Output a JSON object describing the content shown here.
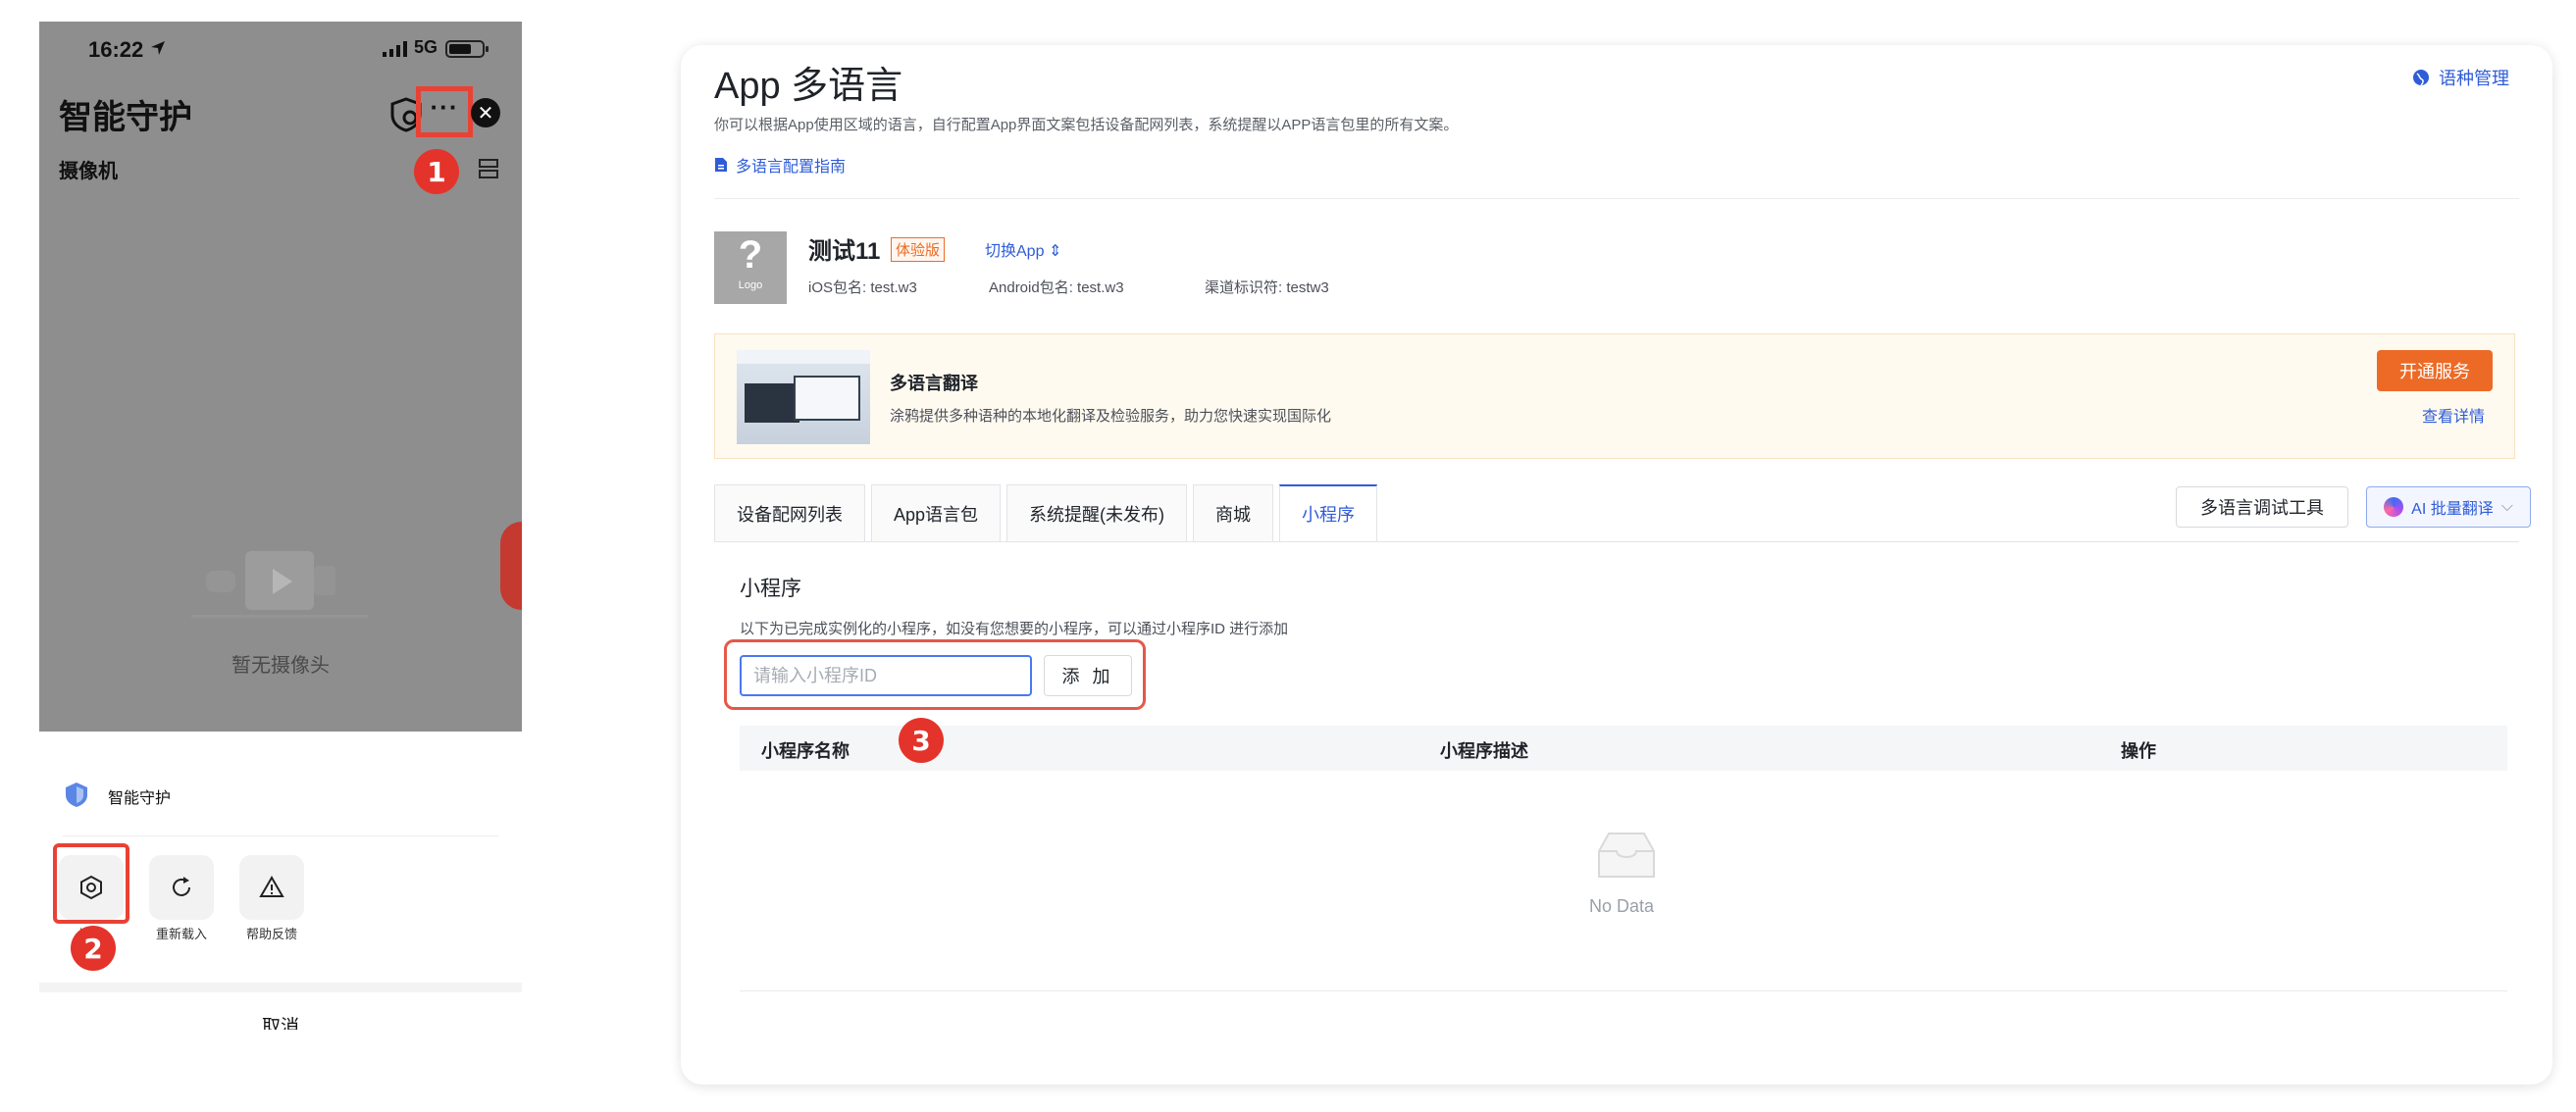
{
  "phone": {
    "status": {
      "time": "16:22",
      "network": "5G"
    },
    "title": "智能守护",
    "subtitle": "摄像机",
    "more_label": "···",
    "empty_text": "暂无摄像头",
    "sheet": {
      "title": "智能守护",
      "actions": [
        {
          "label": "设置",
          "icon": "settings-icon"
        },
        {
          "label": "重新载入",
          "icon": "reload-icon"
        },
        {
          "label": "帮助反馈",
          "icon": "warning-icon"
        }
      ],
      "cancel": "取消"
    }
  },
  "badges": [
    "1",
    "2",
    "3"
  ],
  "console": {
    "title": "App 多语言",
    "description": "你可以根据App使用区域的语言，自行配置App界面文案包括设备配网列表，系统提醒以APP语言包里的所有文案。",
    "guide_link": "多语言配置指南",
    "lang_mgmt": "语种管理",
    "app": {
      "logo_mark": "?",
      "logo_text": "Logo",
      "name": "测试11",
      "tag": "体验版",
      "switch": "切换App",
      "ios": "iOS包名: test.w3",
      "android": "Android包名: test.w3",
      "channel": "渠道标识符: testw3"
    },
    "promo": {
      "title": "多语言翻译",
      "desc": "涂鸦提供多种语种的本地化翻译及检验服务，助力您快速实现国际化",
      "button": "开通服务",
      "link": "查看详情"
    },
    "tabs": [
      "设备配网列表",
      "App语言包",
      "系统提醒(未发布)",
      "商城",
      "小程序"
    ],
    "active_tab": "小程序",
    "tools": {
      "debug": "多语言调试工具",
      "ai": "AI 批量翻译"
    },
    "section": {
      "title": "小程序",
      "desc": "以下为已完成实例化的小程序，如没有您想要的小程序，可以通过小程序ID 进行添加",
      "input_placeholder": "请输入小程序ID",
      "add_button": "添 加"
    },
    "table": {
      "columns": [
        "小程序名称",
        "小程序描述",
        "操作"
      ],
      "empty": "No Data"
    }
  },
  "colors": {
    "accent": "#2f5cd8",
    "highlight": "#e84235",
    "promo": "#ec6a26"
  }
}
